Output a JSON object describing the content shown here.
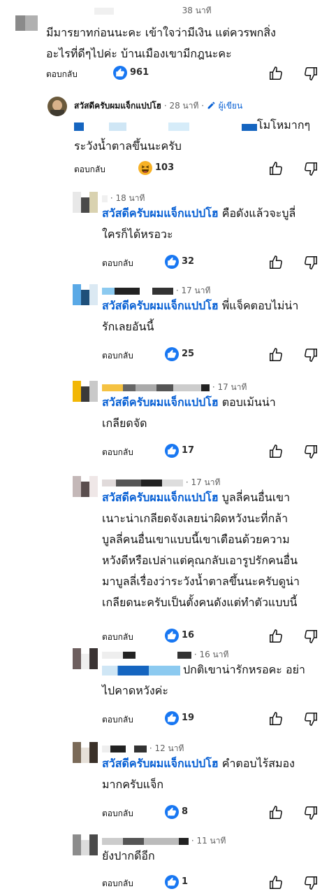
{
  "top_comment": {
    "time": "38 นาที",
    "text_lines": [
      "มีมารยาทก่อนนะคะ เข้าใจว่ามีเงิน แต่ควรพกสิ่ง",
      "อะไรที่ดีๆไปค่ะ บ้านเมืองเขามีกฎนะคะ"
    ],
    "reply_label": "ตอบกลับ",
    "reaction_count": "961",
    "reaction_icon": "like-icon"
  },
  "author_reply": {
    "author": "สวัสดีครับผมแจ็กแปปโฮ",
    "time": "28 นาที",
    "author_badge": "ผู้เขียน",
    "text_lines": [
      "โมโหมากๆ",
      "ระวังน้ำตาลขึ้นนะครับ"
    ],
    "reply_label": "ตอบกลับ",
    "reaction_count": "103",
    "reaction_icon": "haha-icon"
  },
  "replies": [
    {
      "time": "18 นาที",
      "mention": "สวัสดีครับผมแจ็กแปปโฮ",
      "text_first": "คือดังแล้วจะบูลี่",
      "text_lines": [
        "ใครก็ได้หรอวะ"
      ],
      "reply_label": "ตอบกลับ",
      "reaction_count": "32"
    },
    {
      "time": "17 นาที",
      "mention": "สวัสดีครับผมแจ็กแปปโฮ",
      "text_first": "พี่แจ็คตอบไม่น่า",
      "text_lines": [
        "รักเลยอันนี้"
      ],
      "reply_label": "ตอบกลับ",
      "reaction_count": "25"
    },
    {
      "time": "17 นาที",
      "mention": "สวัสดีครับผมแจ็กแปปโฮ",
      "text_first": "ตอบเม้นน่า",
      "text_lines": [
        "เกลียดจัด"
      ],
      "reply_label": "ตอบกลับ",
      "reaction_count": "17"
    },
    {
      "time": "17 นาที",
      "mention": "สวัสดีครับผมแจ็กแปปโฮ",
      "text_first": "บูลลี่คนอื่นเขา",
      "text_lines": [
        "เนาะน่าเกลียดจังเลยน่าผิดหวังนะที่กล้า",
        "บูลลี่คนอื่นเขาแบบนี้เขาเตือนด้วยความ",
        "หวังดีหรือเปล่าแต่คุณกลับเอารูปรักคนอื่น",
        "มาบูลลี่เรื่องว่าระวังน้ำตาลขึ้นนะครับดูน่า",
        "เกลียดนะครับเป็นตั้งคนดังแต่ทำตัวแบบนี้"
      ],
      "reply_label": "ตอบกลับ",
      "reaction_count": "16"
    },
    {
      "time": "16 นาที",
      "mention": "",
      "text_first": "ปกติเขาน่ารักหรอคะ อย่า",
      "text_lines": [
        "ไปคาดหวังค่ะ"
      ],
      "reply_label": "ตอบกลับ",
      "reaction_count": "19"
    },
    {
      "time": "12 นาที",
      "mention": "สวัสดีครับผมแจ็กแปปโฮ",
      "text_first": "คำตอบไร้สมอง",
      "text_lines": [
        "มากครับแจ็ก"
      ],
      "reply_label": "ตอบกลับ",
      "reaction_count": "8"
    },
    {
      "time": "11 นาที",
      "mention": "",
      "text_first": "ยังปากดีอีก",
      "text_lines": [],
      "reply_label": "ตอบกลับ",
      "reaction_count": "1"
    }
  ],
  "colors": {
    "mention": "#065fd4",
    "like_badge": "#1877f2",
    "haha_badge": "#f7b125",
    "secondary_text": "#606060"
  }
}
